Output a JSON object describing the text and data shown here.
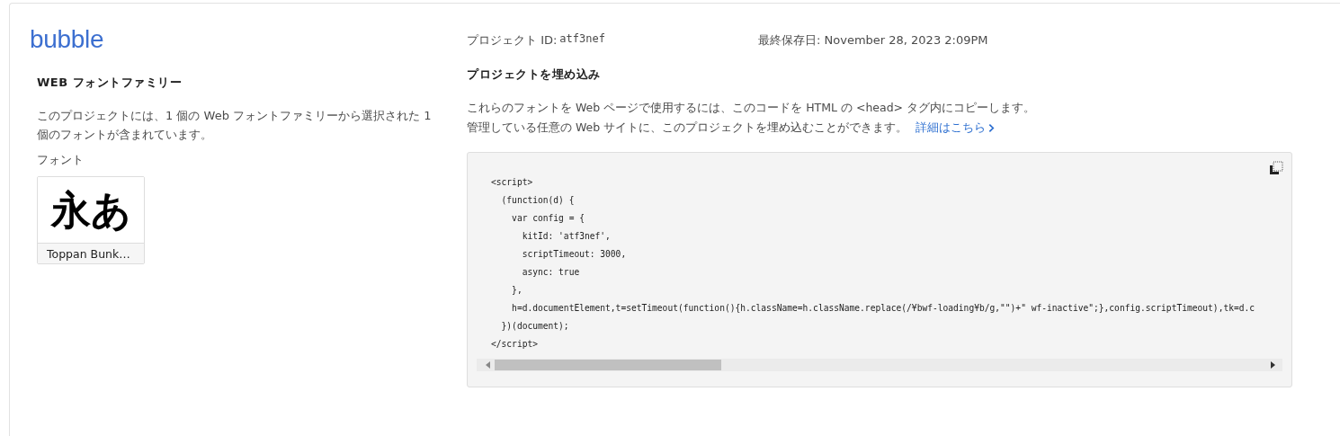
{
  "logo": "bubble",
  "project_id": {
    "label": "プロジェクト ID:",
    "value": "atf3nef"
  },
  "last_saved": "最終保存日: November 28, 2023 2:09PM",
  "font_family": {
    "heading": "WEB フォントファミリー",
    "description": "このプロジェクトには、1 個の Web フォントファミリーから選択された 1 個のフォントが含まれています。",
    "fonts_label": "フォント",
    "fonts": [
      {
        "sample": "永あ",
        "name": "Toppan Bunk…"
      }
    ]
  },
  "embed": {
    "heading": "プロジェクトを埋め込み",
    "line_1": "これらのフォントを Web ページで使用するには、このコードを HTML の <head> タグ内にコピーします。",
    "line_2": "管理している任意の Web サイトに、このプロジェクトを埋め込むことができます。",
    "link": "詳細はこちら",
    "code_lines": [
      "<script>",
      "  (function(d) {",
      "    var config = {",
      "      kitId: 'atf3nef',",
      "      scriptTimeout: 3000,",
      "      async: true",
      "    },",
      "    h=d.documentElement,t=setTimeout(function(){h.className=h.className.replace(/¥bwf-loading¥b/g,\"\")+\" wf-inactive\";},config.scriptTimeout),tk=d.c",
      "  })(document);",
      "</script>"
    ]
  }
}
